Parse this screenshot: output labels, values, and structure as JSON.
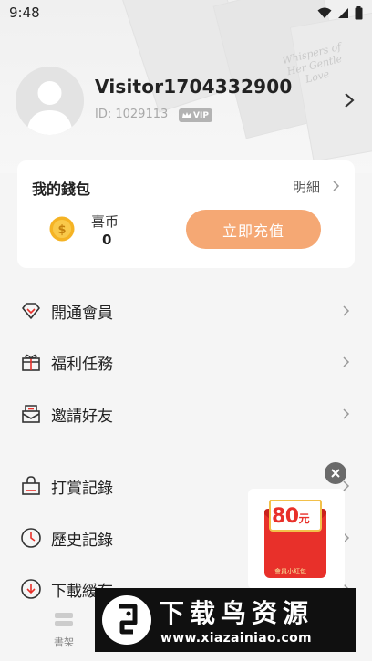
{
  "status_bar": {
    "time": "9:48"
  },
  "profile": {
    "username": "Visitor1704332900",
    "user_id": "ID: 1029113",
    "vip_badge": "VIP"
  },
  "background_script": "Whispers of Her Gentle Love",
  "wallet": {
    "title": "我的錢包",
    "detail_label": "明細",
    "coin_label": "喜币",
    "coin_amount": "0",
    "recharge_label": "立即充值"
  },
  "menu": [
    {
      "label": "開通會員",
      "icon": "diamond-icon"
    },
    {
      "label": "福利任務",
      "icon": "gift-icon"
    },
    {
      "label": "邀請好友",
      "icon": "invite-letter-icon"
    },
    {
      "label": "打賞記錄",
      "icon": "shopping-bag-icon"
    },
    {
      "label": "歷史記錄",
      "icon": "clock-icon"
    },
    {
      "label": "下載緩存",
      "icon": "download-icon"
    }
  ],
  "red_packet": {
    "amount": "80",
    "unit": "元",
    "label": "會員小紅包"
  },
  "bottom_tab": {
    "label": "書架",
    "icon": "bookshelf-icon"
  },
  "watermark": {
    "title": "下载鸟资源",
    "url": "www.xiazainiao.com"
  },
  "colors": {
    "accent": "#f5a874",
    "background": "#f5f5f5",
    "card": "#ffffff",
    "red_packet": "#e8302a",
    "coin": "#f5b324"
  }
}
